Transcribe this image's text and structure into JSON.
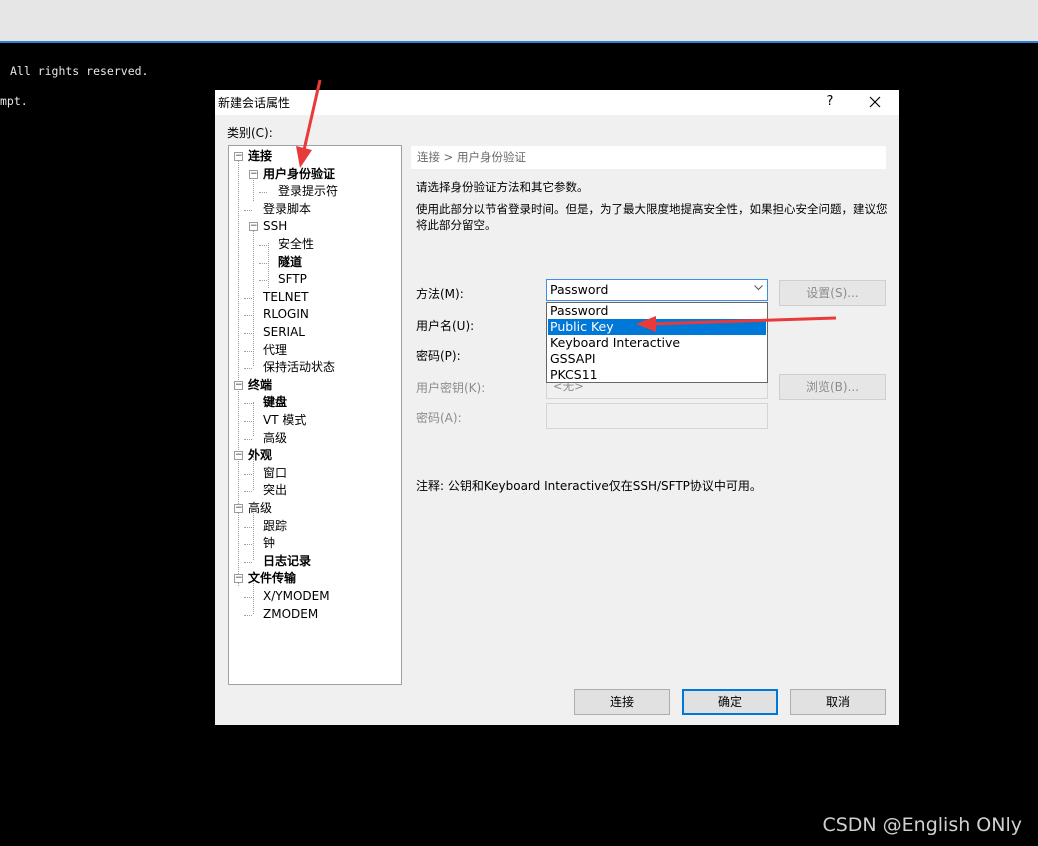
{
  "terminal": {
    "line1": "All rights reserved.",
    "line2": "mpt."
  },
  "dialog": {
    "title": "新建会话属性",
    "help_label": "?",
    "close_label": "✕",
    "category_label": "类别(C):",
    "tree": [
      {
        "label": "连接",
        "bold": true,
        "expander": "−"
      },
      {
        "label": "用户身份验证",
        "bold": true,
        "expander": "−",
        "selected": true
      },
      {
        "label": "登录提示符"
      },
      {
        "label": "登录脚本"
      },
      {
        "label": "SSH",
        "expander": "−"
      },
      {
        "label": "安全性"
      },
      {
        "label": "隧道",
        "bold": true
      },
      {
        "label": "SFTP"
      },
      {
        "label": "TELNET"
      },
      {
        "label": "RLOGIN"
      },
      {
        "label": "SERIAL"
      },
      {
        "label": "代理"
      },
      {
        "label": "保持活动状态"
      },
      {
        "label": "终端",
        "bold": true,
        "expander": "−"
      },
      {
        "label": "键盘",
        "bold": true
      },
      {
        "label": "VT 模式"
      },
      {
        "label": "高级"
      },
      {
        "label": "外观",
        "bold": true,
        "expander": "−"
      },
      {
        "label": "窗口"
      },
      {
        "label": "突出"
      },
      {
        "label": "高级",
        "expander": "−"
      },
      {
        "label": "跟踪"
      },
      {
        "label": "钟"
      },
      {
        "label": "日志记录",
        "bold": true
      },
      {
        "label": "文件传输",
        "bold": true,
        "expander": "−"
      },
      {
        "label": "X/YMODEM"
      },
      {
        "label": "ZMODEM"
      }
    ],
    "breadcrumb": "连接 > 用户身份验证",
    "description_1": "请选择身份验证方法和其它参数。",
    "description_2": "使用此部分以节省登录时间。但是，为了最大限度地提高安全性，如果担心安全问题，建议您将此部分留空。",
    "method_label": "方法(M):",
    "method_value": "Password",
    "method_options": [
      "Password",
      "Public Key",
      "Keyboard Interactive",
      "GSSAPI",
      "PKCS11"
    ],
    "method_highlighted": "Public Key",
    "username_label": "用户名(U):",
    "password_label": "密码(P):",
    "user_key_label": "用户密钥(K):",
    "user_key_value": "<无>",
    "passphrase_label": "密码(A):",
    "settings_button": "设置(S)...",
    "browse_button": "浏览(B)...",
    "note": "注释: 公钥和Keyboard Interactive仅在SSH/SFTP协议中可用。",
    "connect_button": "连接",
    "ok_button": "确定",
    "cancel_button": "取消"
  },
  "watermark": "CSDN @English ONly",
  "colors": {
    "accent": "#0078d7",
    "annotation_arrow": "#e83a3a"
  }
}
